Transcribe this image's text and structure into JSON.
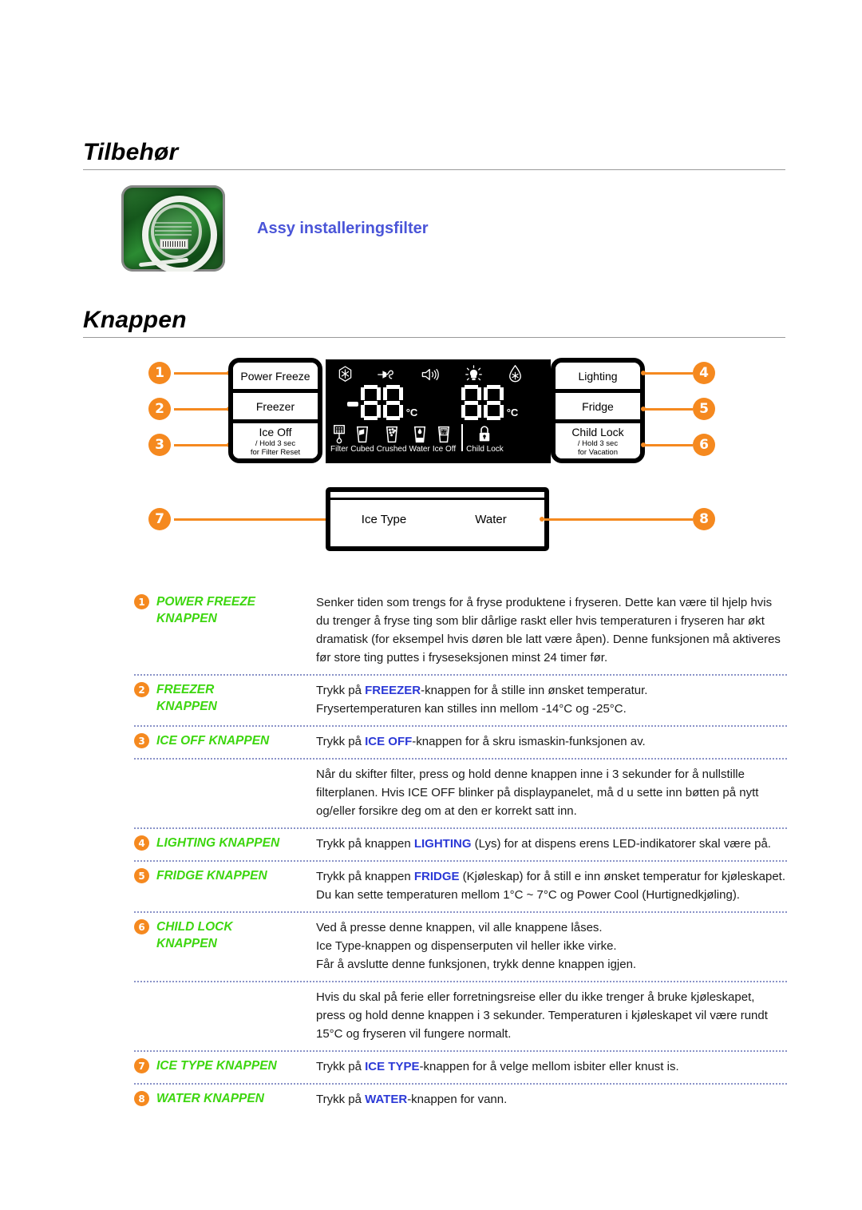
{
  "sections": {
    "accessories": {
      "heading": "Tilbehør",
      "item_label": "Assy installeringsfilter",
      "image_name": "water-filter-tube-package"
    },
    "buttons": {
      "heading": "Knappen"
    }
  },
  "panel": {
    "left_buttons": [
      {
        "label": "Power Freeze",
        "sub": "",
        "callout": "1"
      },
      {
        "label": "Freezer",
        "sub": "",
        "callout": "2"
      },
      {
        "label": "Ice Off",
        "sub": "/ Hold 3 sec\nfor Filter Reset",
        "callout": "3"
      }
    ],
    "right_buttons": [
      {
        "label": "Lighting",
        "sub": "",
        "callout": "4"
      },
      {
        "label": "Fridge",
        "sub": "",
        "callout": "5"
      },
      {
        "label": "Child Lock",
        "sub": "/ Hold 3 sec\nfor Vacation",
        "callout": "6"
      }
    ],
    "dispenser_buttons": [
      {
        "label": "Ice Type",
        "callout": "7"
      },
      {
        "label": "Water",
        "callout": "8"
      }
    ],
    "lcd": {
      "top_icons": [
        "power-freeze-snowflake",
        "energy-saver-plug",
        "alarm-speaker",
        "lighting-bulb",
        "power-cool-drop"
      ],
      "freezer_temp": "-88",
      "fridge_temp": "88",
      "unit": "°C",
      "status_items": [
        {
          "caption": "Filter",
          "icon": "filter-icon"
        },
        {
          "caption": "Cubed",
          "icon": "cubed-ice-glass-icon"
        },
        {
          "caption": "Crushed",
          "icon": "crushed-ice-glass-icon"
        },
        {
          "caption": "Water",
          "icon": "water-glass-icon"
        },
        {
          "caption": "Ice Off",
          "icon": "ice-off-glass-icon"
        },
        {
          "caption": "Child Lock",
          "icon": "padlock-icon"
        }
      ]
    }
  },
  "descriptions": [
    {
      "num": "1",
      "title": "POWER FREEZE\nKNAPPEN",
      "body_html": "Senker tiden som trengs for å fryse produktene i fryseren. Dette kan være til hjelp hvis du trenger å fryse ting som blir dårlige raskt eller hvis temperaturen i fryseren har økt dramatisk (for eksempel hvis døren ble latt være åpen). Denne funksjonen må aktiveres før store ting puttes i fryseseksjonen minst 24 timer før."
    },
    {
      "num": "2",
      "title": "FREEZER\nKNAPPEN",
      "body_html": "Trykk på <b>FREEZER</b>-knappen for å stille inn ønsket temperatur.\nFrysertemperaturen kan stilles inn mellom -14°C og -25°C."
    },
    {
      "num": "3",
      "title": "ICE OFF KNAPPEN",
      "body_html": "Trykk på <b>ICE OFF</b>-knappen for å skru ismaskin-funksjonen av."
    },
    {
      "num": "",
      "title": "",
      "body_html": "Når du skifter filter, press og hold denne knappen inne i 3 sekunder for å nullstille filterplanen. Hvis ICE OFF blinker på displaypanelet, må d u sette inn bøtten på nytt og/eller forsikre deg om at den er korrekt satt inn."
    },
    {
      "num": "4",
      "title": "LIGHTING KNAPPEN",
      "body_html": "Trykk på knappen <b>LIGHTING</b> (Lys) for at dispens erens LED-indikatorer skal være på."
    },
    {
      "num": "5",
      "title": "FRIDGE KNAPPEN",
      "body_html": "Trykk på knappen <b>FRIDGE</b> (Kjøleskap) for å still e inn ønsket temperatur for kjøleskapet. Du kan sette temperaturen mellom 1°C ~ 7°C og Power Cool (Hurtignedkjøling)."
    },
    {
      "num": "6",
      "title": "CHILD LOCK\nKNAPPEN",
      "body_html": "Ved å presse denne knappen, vil alle knappene låses.\nIce Type-knappen og dispenserputen vil heller ikke virke.\nFår å avslutte denne funksjonen, trykk denne knappen igjen."
    },
    {
      "num": "",
      "title": "",
      "body_html": "Hvis du skal på ferie eller forretningsreise eller du ikke trenger å bruke kjøleskapet, press og hold denne knappen i 3 sekunder. Temperaturen i kjøleskapet vil være rundt 15°C og fryseren vil fungere normalt."
    },
    {
      "num": "7",
      "title": "ICE TYPE KNAPPEN",
      "body_html": "Trykk på <b>ICE TYPE</b>-knappen for å velge mellom isbiter eller knust is."
    },
    {
      "num": "8",
      "title": "WATER KNAPPEN",
      "body_html": "Trykk på <b>WATER</b>-knappen for vann."
    }
  ],
  "colors": {
    "accent_orange": "#f5891f",
    "title_green": "#3dd60f",
    "emphasis_blue": "#2b39d6",
    "link_blue": "#4a55d8",
    "rule_gray": "#9a9a9a",
    "dotted_rule": "#8a93c8"
  }
}
